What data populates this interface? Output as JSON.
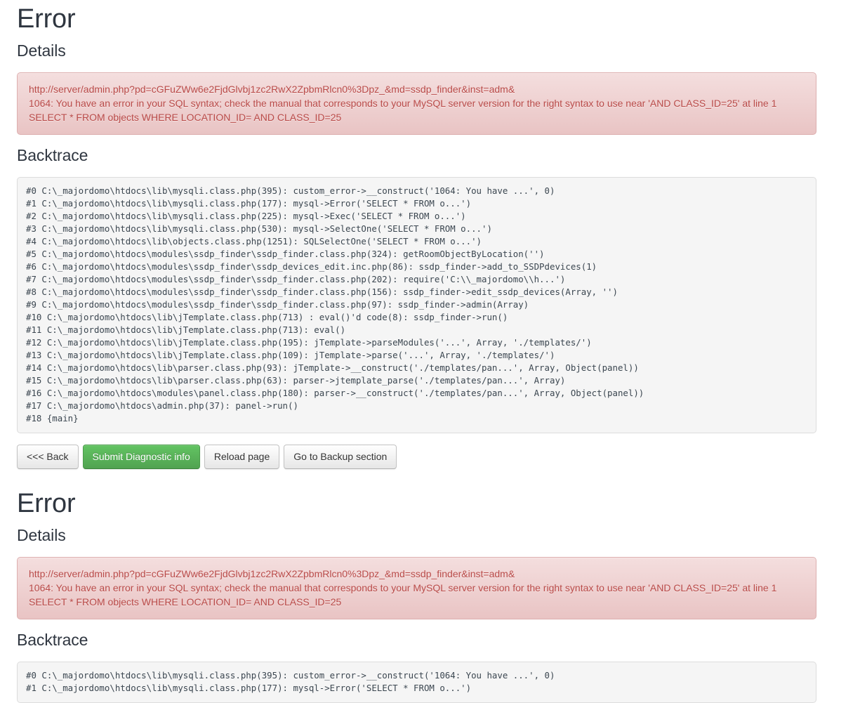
{
  "sections": [
    {
      "title": "Error",
      "details_heading": "Details",
      "alert_lines": [
        "http://server/admin.php?pd=cGFuZWw6e2FjdGlvbj1zc2RwX2ZpbmRlcn0%3Dpz_&md=ssdp_finder&inst=adm&",
        "1064: You have an error in your SQL syntax; check the manual that corresponds to your MySQL server version for the right syntax to use near 'AND CLASS_ID=25' at line 1",
        "SELECT * FROM objects WHERE LOCATION_ID= AND CLASS_ID=25"
      ],
      "backtrace_heading": "Backtrace",
      "backtrace": "#0 C:\\_majordomo\\htdocs\\lib\\mysqli.class.php(395): custom_error->__construct('1064: You have ...', 0)\n#1 C:\\_majordomo\\htdocs\\lib\\mysqli.class.php(177): mysql->Error('SELECT * FROM o...')\n#2 C:\\_majordomo\\htdocs\\lib\\mysqli.class.php(225): mysql->Exec('SELECT * FROM o...')\n#3 C:\\_majordomo\\htdocs\\lib\\mysqli.class.php(530): mysql->SelectOne('SELECT * FROM o...')\n#4 C:\\_majordomo\\htdocs\\lib\\objects.class.php(1251): SQLSelectOne('SELECT * FROM o...')\n#5 C:\\_majordomo\\htdocs\\modules\\ssdp_finder\\ssdp_finder.class.php(324): getRoomObjectByLocation('')\n#6 C:\\_majordomo\\htdocs\\modules\\ssdp_finder\\ssdp_devices_edit.inc.php(86): ssdp_finder->add_to_SSDPdevices(1)\n#7 C:\\_majordomo\\htdocs\\modules\\ssdp_finder\\ssdp_finder.class.php(202): require('C:\\\\_majordomo\\\\h...')\n#8 C:\\_majordomo\\htdocs\\modules\\ssdp_finder\\ssdp_finder.class.php(156): ssdp_finder->edit_ssdp_devices(Array, '')\n#9 C:\\_majordomo\\htdocs\\modules\\ssdp_finder\\ssdp_finder.class.php(97): ssdp_finder->admin(Array)\n#10 C:\\_majordomo\\htdocs\\lib\\jTemplate.class.php(713) : eval()'d code(8): ssdp_finder->run()\n#11 C:\\_majordomo\\htdocs\\lib\\jTemplate.class.php(713): eval()\n#12 C:\\_majordomo\\htdocs\\lib\\jTemplate.class.php(195): jTemplate->parseModules('...', Array, './templates/')\n#13 C:\\_majordomo\\htdocs\\lib\\jTemplate.class.php(109): jTemplate->parse('...', Array, './templates/')\n#14 C:\\_majordomo\\htdocs\\lib\\parser.class.php(93): jTemplate->__construct('./templates/pan...', Array, Object(panel))\n#15 C:\\_majordomo\\htdocs\\lib\\parser.class.php(63): parser->jtemplate_parse('./templates/pan...', Array)\n#16 C:\\_majordomo\\htdocs\\modules\\panel.class.php(180): parser->__construct('./templates/pan...', Array, Object(panel))\n#17 C:\\_majordomo\\htdocs\\admin.php(37): panel->run()\n#18 {main}",
      "buttons": [
        {
          "label": "<<< Back",
          "style": "default"
        },
        {
          "label": "Submit Diagnostic info",
          "style": "green"
        },
        {
          "label": "Reload page",
          "style": "default"
        },
        {
          "label": "Go to Backup section",
          "style": "default"
        }
      ]
    },
    {
      "title": "Error",
      "details_heading": "Details",
      "alert_lines": [
        "http://server/admin.php?pd=cGFuZWw6e2FjdGlvbj1zc2RwX2ZpbmRlcn0%3Dpz_&md=ssdp_finder&inst=adm&",
        "1064: You have an error in your SQL syntax; check the manual that corresponds to your MySQL server version for the right syntax to use near 'AND CLASS_ID=25' at line 1",
        "SELECT * FROM objects WHERE LOCATION_ID= AND CLASS_ID=25"
      ],
      "backtrace_heading": "Backtrace",
      "backtrace": "#0 C:\\_majordomo\\htdocs\\lib\\mysqli.class.php(395): custom_error->__construct('1064: You have ...', 0)\n#1 C:\\_majordomo\\htdocs\\lib\\mysqli.class.php(177): mysql->Error('SELECT * FROM o...')"
    }
  ],
  "colors": {
    "alert_text": "#b94a48",
    "alert_border": "#ddafaf",
    "alert_bg_top": "#f4dede",
    "alert_bg_bottom": "#e9c4c4",
    "heading_text": "#2f3640",
    "code_text": "#3b4650",
    "code_bg": "#f5f5f5",
    "green_button": "#51a351"
  }
}
